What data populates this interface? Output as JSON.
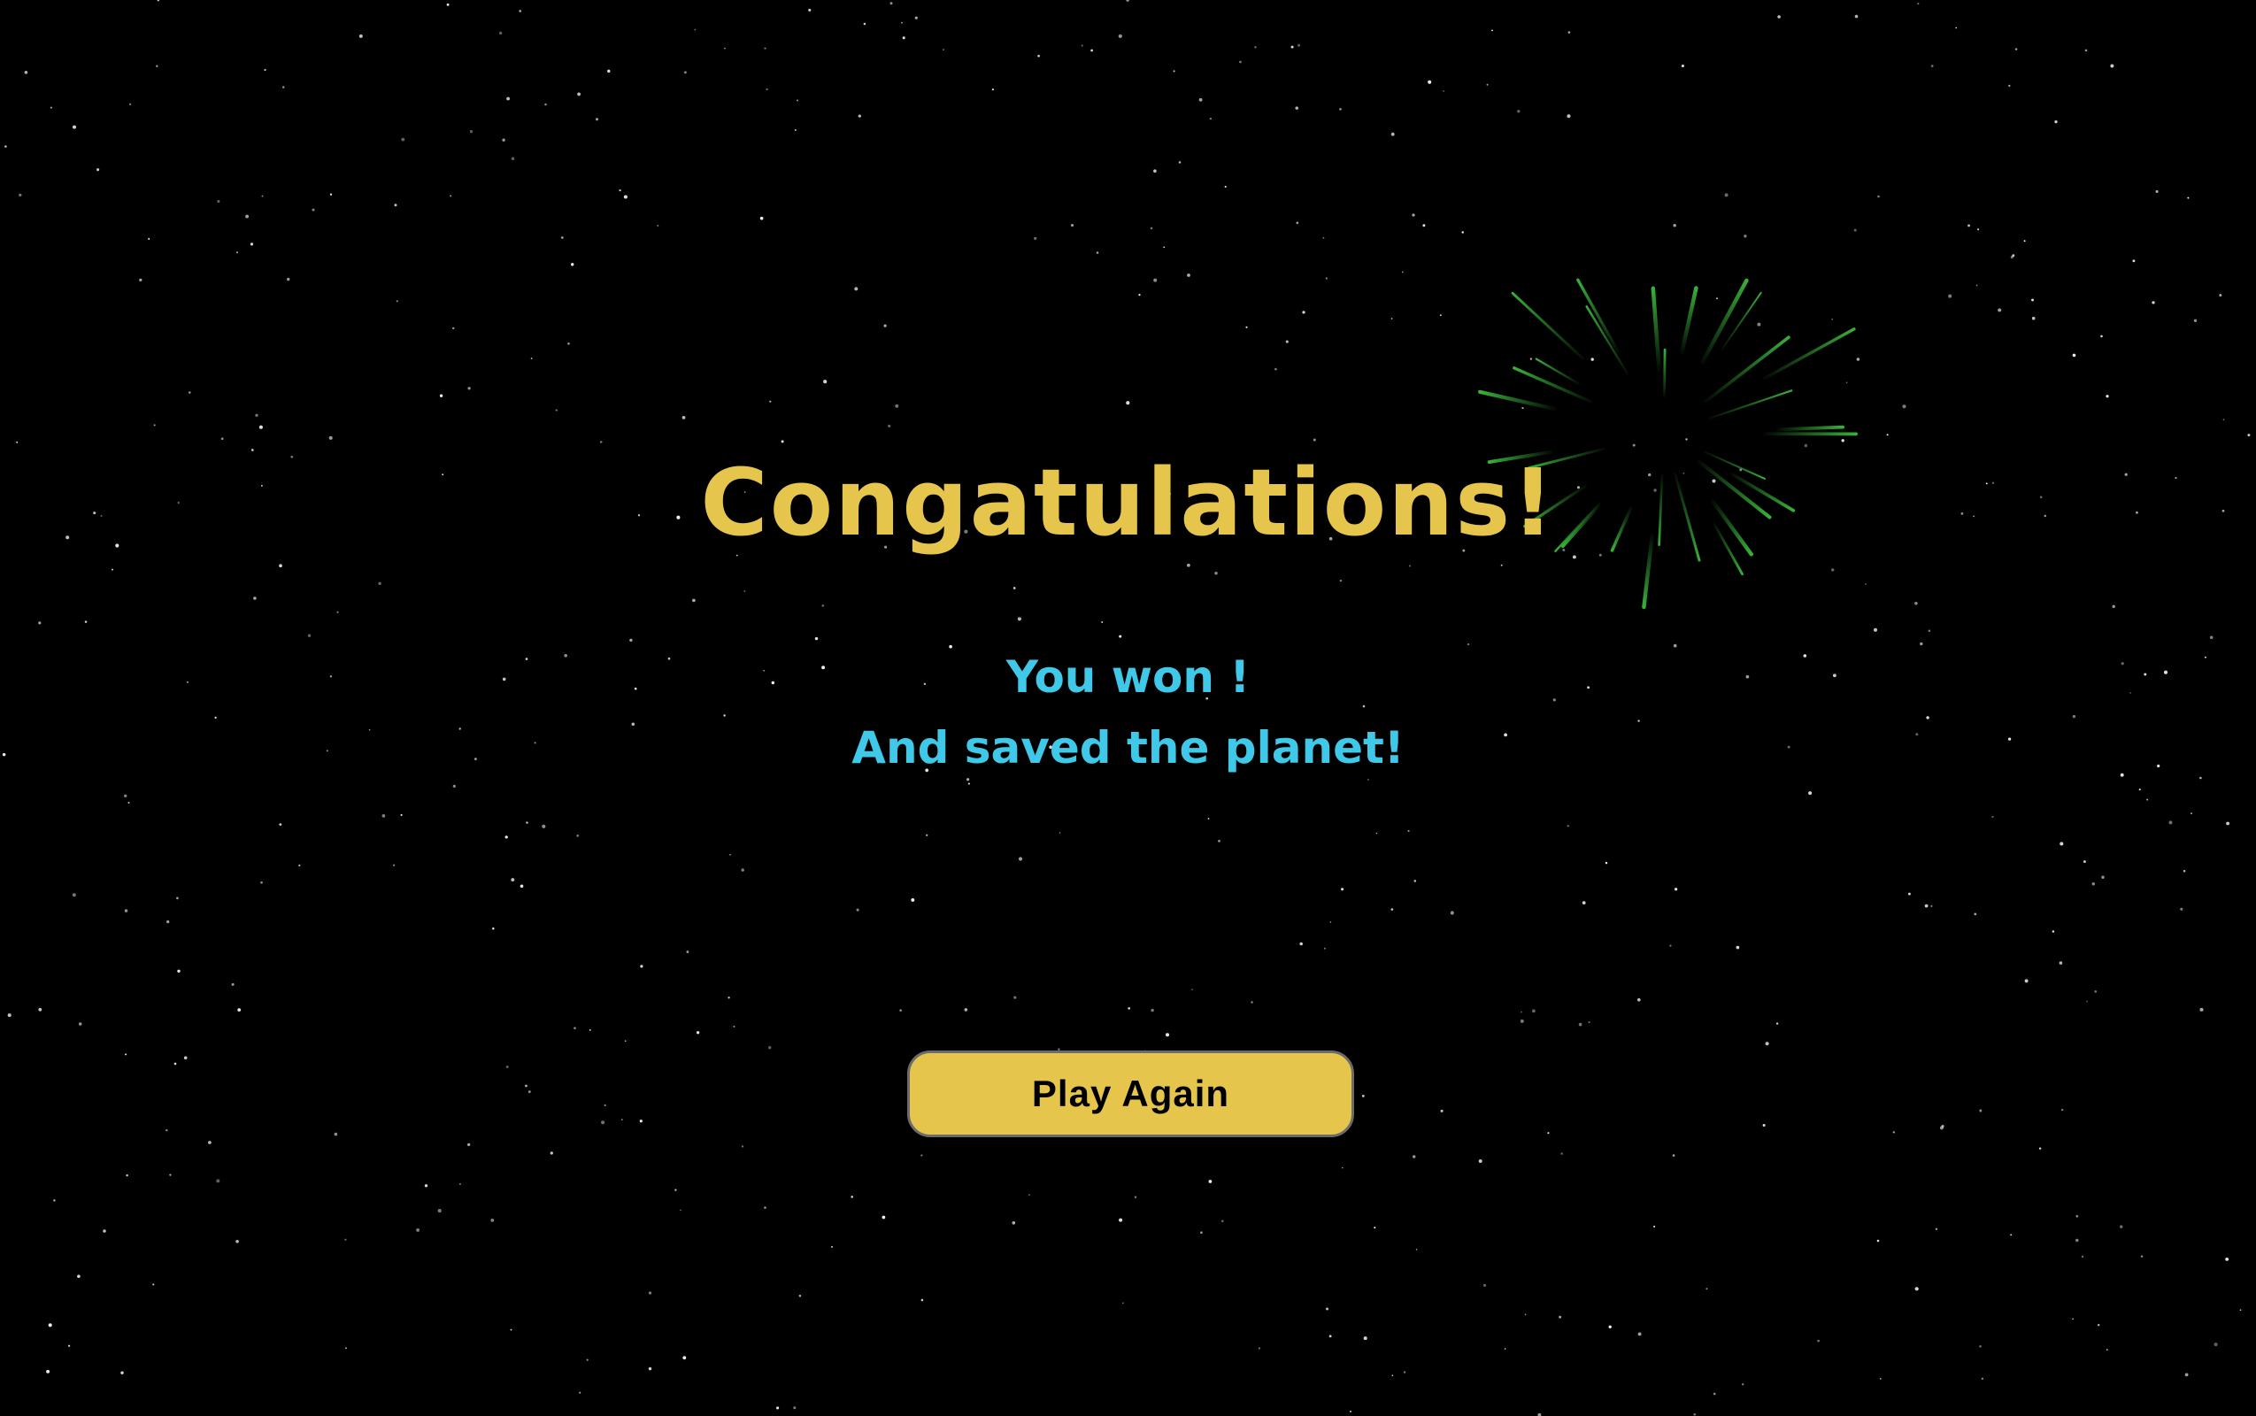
{
  "screen": {
    "title": "Congatulations!",
    "message_line_1": "You won !",
    "message_line_2": "And saved the planet!",
    "play_again_label": "Play Again"
  },
  "colors": {
    "background": "#000000",
    "title": "#e6c54d",
    "message": "#3fc8e8",
    "button_fill": "#e6c54d",
    "button_text": "#000000",
    "firework": "#3ec43e",
    "stars": "#ffffff"
  },
  "decorations": {
    "firework_icon": "firework-burst-icon",
    "background_icon": "starfield"
  }
}
